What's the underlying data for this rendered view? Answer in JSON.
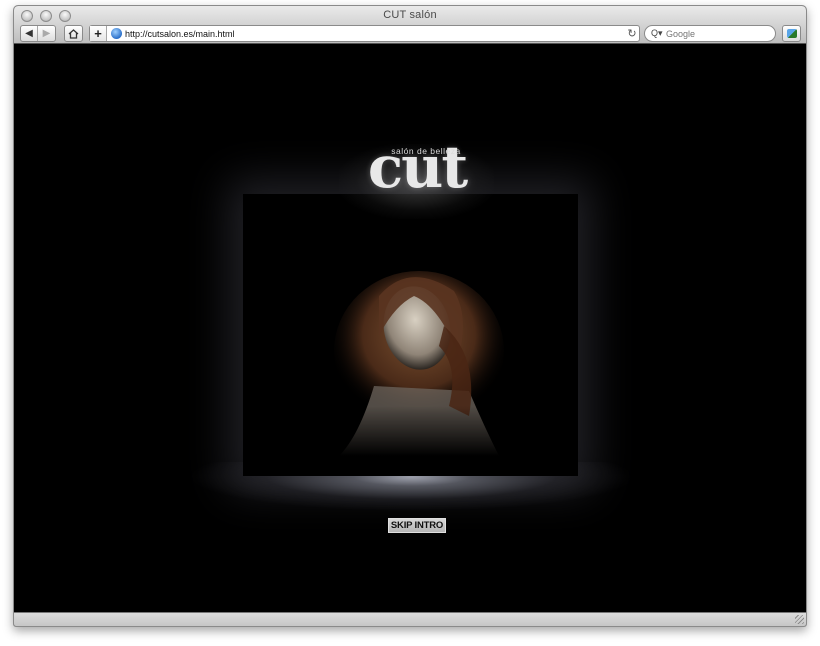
{
  "window": {
    "title": "CUT salón"
  },
  "toolbar": {
    "back_icon": "back-arrow-icon",
    "forward_icon": "forward-arrow-icon",
    "home_icon": "home-icon",
    "add_bookmark_icon": "plus-icon",
    "reload_icon": "reload-icon",
    "snapback_icon": "bookmarks-icon"
  },
  "address_bar": {
    "url": "http://cutsalon.es/main.html"
  },
  "search": {
    "placeholder": "Google"
  },
  "page": {
    "logo_tagline": "salón de belleza",
    "logo_word": "cut",
    "skip_label": "SKIP INTRO",
    "colors": {
      "background": "#000000",
      "logo": "#e8e8e8",
      "skip_button": "#c4c4c4"
    }
  }
}
